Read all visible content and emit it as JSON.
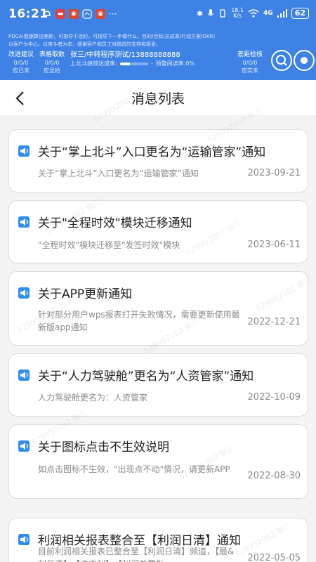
{
  "status_bar": {
    "time": "16:21",
    "net_speed_top": "18.1",
    "net_speed_bottom": "K/s",
    "network": "4G",
    "battery": "62"
  },
  "banner": {
    "intro_line1": "PDCA(数据算出差距，可指导干活的，可指导下一步做什么，目的/目标/达成率/行动方案/OKR)",
    "intro_line2": "以客户为中心，以奋斗者为本，感谢客户和员工对跑达的支持和厚爱。",
    "stat1": {
      "title": "改进建议",
      "value": "0/0/0",
      "sub": "应已未"
    },
    "stat2": {
      "title": "表格取数",
      "value": "0/0/0",
      "sub": "应显给"
    },
    "user": "张三/中转程序测试/13888888888",
    "progress_label": "上北斗绩效达成率:",
    "progress_value": 0.35,
    "warning": "预警阅读率:0%",
    "stat3": {
      "title": "差距检核",
      "value": "0/0/0",
      "sub": "应实未"
    }
  },
  "nav": {
    "title": "消息列表"
  },
  "messages": [
    {
      "title": "关于“掌上北斗”入口更名为“运输管家”通知",
      "desc": "关于“掌上北斗”入口更名为“运输管家”通知",
      "date": "2023-09-21"
    },
    {
      "title": "关于\"全程时效\"模块迁移通知",
      "desc": "\"全程时效\"模块迁移至\"发签时效\"模块",
      "date": "2023-06-11"
    },
    {
      "title": "关于APP更新通知",
      "desc": "针对部分用户wps报表打开失败情况，需要更新使用最新版app通知",
      "date": "2022-12-21"
    },
    {
      "title": "关于“人力驾驶舱”更名为“人资管家”通知",
      "desc": "人力驾驶舱更名为：人资管家",
      "date": "2022-10-09"
    },
    {
      "title": "关于图标点击不生效说明",
      "desc": "如点击图标不生效，\"出现点不动\"情况，请更新APP",
      "date": "2022-08-30"
    },
    {
      "title": "利润相关报表整合至【利润日清】通知",
      "desc": "目前利润相关报表已整合至【利润日清】频道，【最&利日清】、【收支利】、【利润单票批",
      "date": "2022-05-05"
    }
  ],
  "watermark": "529952002 张三",
  "colors": {
    "brand": "#3f82e6",
    "icon_blue": "#2f8cf0"
  }
}
